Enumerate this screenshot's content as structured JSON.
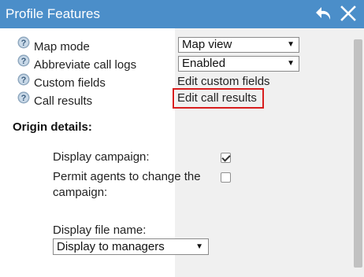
{
  "window": {
    "title": "Profile Features",
    "back_icon": "undo-arrow-icon",
    "close_icon": "close-x-icon",
    "title_bar_color": "#4b8ec9"
  },
  "features": [
    {
      "label": "Map mode",
      "control": "select",
      "value": "Map view",
      "help_icon": "question-circle-icon"
    },
    {
      "label": "Abbreviate call logs",
      "control": "select",
      "value": "Enabled",
      "help_icon": "question-circle-icon"
    },
    {
      "label": "Custom fields",
      "control": "link",
      "value": "Edit custom fields",
      "help_icon": "question-circle-icon"
    },
    {
      "label": "Call results",
      "control": "link",
      "value": "Edit call results",
      "help_icon": "question-circle-icon",
      "highlighted": true
    }
  ],
  "origin_details": {
    "heading": "Origin details:",
    "display_campaign": {
      "label": "Display campaign:",
      "checked": true
    },
    "permit_agents": {
      "label_line1": "Permit agents to change the",
      "label_line2": "campaign:",
      "checked": false
    },
    "display_file_name": {
      "label": "Display file name:",
      "value": "Display to managers"
    }
  },
  "colors": {
    "highlight_border": "#d81e1e"
  }
}
